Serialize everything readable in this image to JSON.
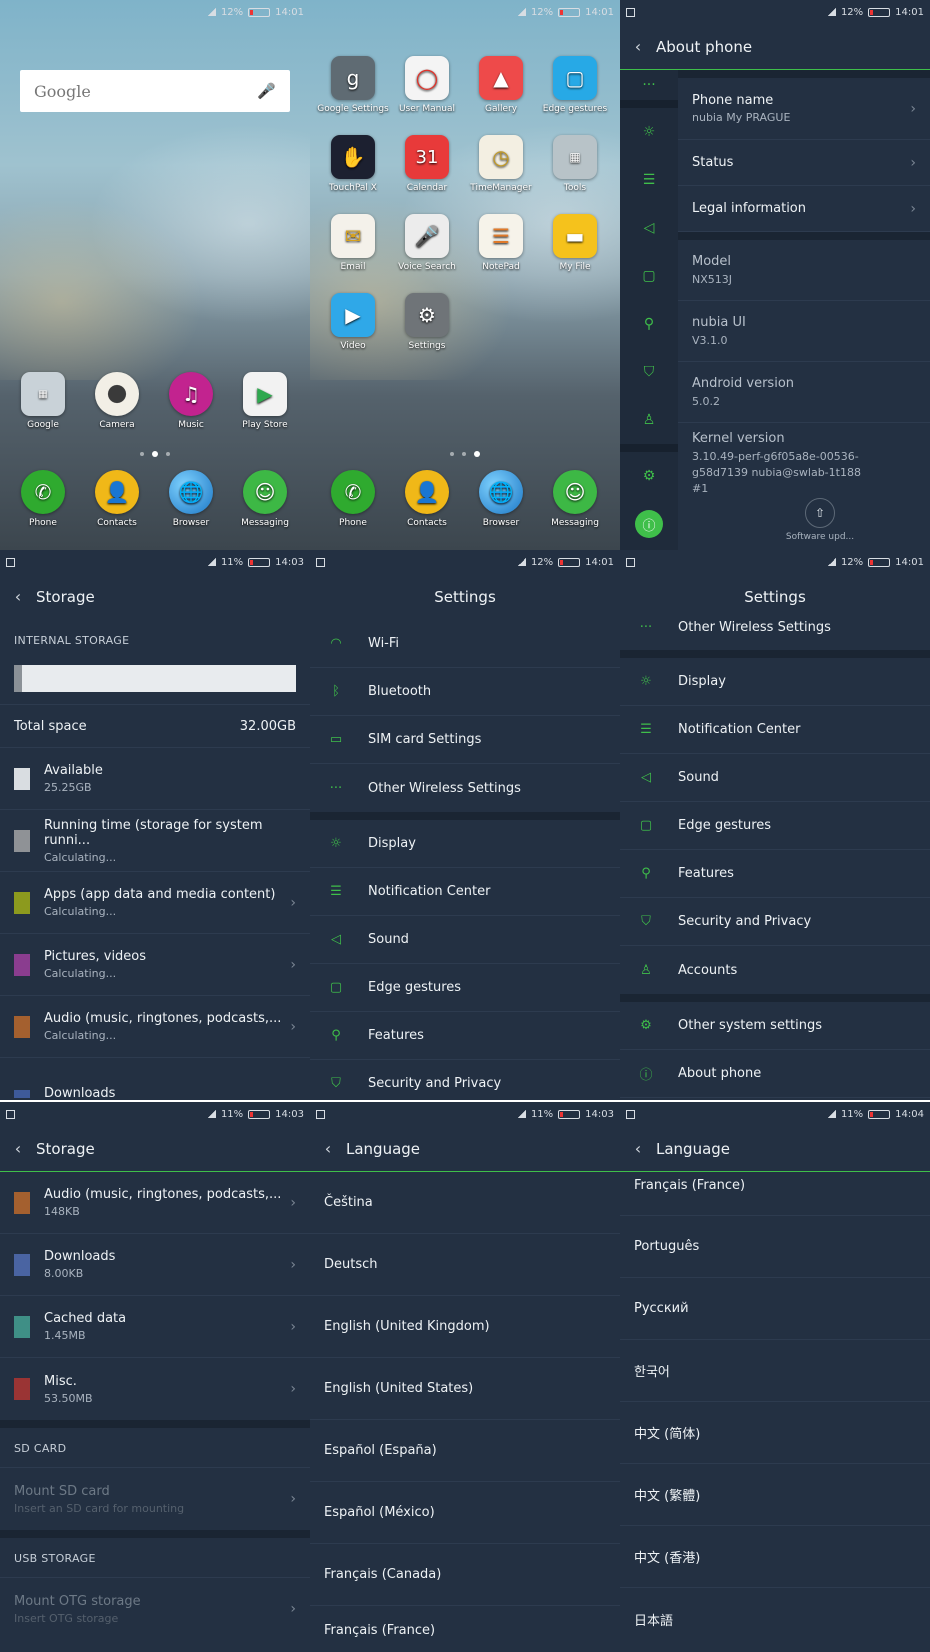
{
  "status": [
    {
      "battery": "12%",
      "time": "14:01"
    },
    {
      "battery": "12%",
      "time": "14:01"
    },
    {
      "battery": "12%",
      "time": "14:01"
    },
    {
      "battery": "11%",
      "time": "14:03"
    },
    {
      "battery": "12%",
      "time": "14:01"
    },
    {
      "battery": "12%",
      "time": "14:01"
    },
    {
      "battery": "11%",
      "time": "14:03"
    },
    {
      "battery": "11%",
      "time": "14:03"
    },
    {
      "battery": "11%",
      "time": "14:04"
    }
  ],
  "home1": {
    "search_label": "Google",
    "apps": [
      "Google",
      "Camera",
      "Music",
      "Play Store"
    ],
    "dock": [
      "Phone",
      "Contacts",
      "Browser",
      "Messaging"
    ]
  },
  "home2": {
    "apps": [
      "Google Settings",
      "User Manual",
      "Gallery",
      "Edge gestures",
      "TouchPal X",
      "Calendar",
      "TimeManager",
      "Tools",
      "Email",
      "Voice Search",
      "NotePad",
      "My File",
      "Video",
      "Settings"
    ],
    "calendar_day": "31",
    "dock": [
      "Phone",
      "Contacts",
      "Browser",
      "Messaging"
    ]
  },
  "about": {
    "title": "About phone",
    "phone_name_label": "Phone name",
    "phone_name_value": "nubia My PRAGUE",
    "status_label": "Status",
    "legal_label": "Legal information",
    "model_label": "Model",
    "model_value": "NX513J",
    "ui_label": "nubia UI",
    "ui_value": "V3.1.0",
    "android_label": "Android version",
    "android_value": "5.0.2",
    "kernel_label": "Kernel version",
    "kernel_value": "3.10.49-perf-g6f05a8e-00536-g58d7139 nubia@swlab-1t188 #1",
    "software_update": "Software upd..."
  },
  "storage1": {
    "title": "Storage",
    "section": "INTERNAL STORAGE",
    "total_label": "Total space",
    "total_value": "32.00GB",
    "items": [
      {
        "label": "Available",
        "sub": "25.25GB",
        "color": "#d9dde1"
      },
      {
        "label": "Running time (storage for system runni...",
        "sub": "Calculating...",
        "color": "#8f9296"
      },
      {
        "label": "Apps (app data and media content)",
        "sub": "Calculating...",
        "color": "#8c9a1e"
      },
      {
        "label": "Pictures, videos",
        "sub": "Calculating...",
        "color": "#8a3d8f"
      },
      {
        "label": "Audio (music, ringtones, podcasts,...",
        "sub": "Calculating...",
        "color": "#a4602f"
      },
      {
        "label": "Downloads",
        "sub": "",
        "color": "#3e5a9a"
      }
    ]
  },
  "settings1": {
    "title": "Settings",
    "items": [
      "Wi-Fi",
      "Bluetooth",
      "SIM card Settings",
      "Other Wireless Settings",
      "Display",
      "Notification Center",
      "Sound",
      "Edge gestures",
      "Features",
      "Security and Privacy"
    ]
  },
  "settings2": {
    "title": "Settings",
    "items": [
      "Other Wireless Settings",
      "Display",
      "Notification Center",
      "Sound",
      "Edge gestures",
      "Features",
      "Security and Privacy",
      "Accounts",
      "Other system settings",
      "About phone"
    ]
  },
  "storage2": {
    "title": "Storage",
    "items": [
      {
        "label": "Audio (music, ringtones, podcasts,...",
        "sub": "148KB",
        "color": "#a4602f"
      },
      {
        "label": "Downloads",
        "sub": "8.00KB",
        "color": "#4a64a2"
      },
      {
        "label": "Cached data",
        "sub": "1.45MB",
        "color": "#3f8f86"
      },
      {
        "label": "Misc.",
        "sub": "53.50MB",
        "color": "#9a3434"
      }
    ],
    "sd_section": "SD CARD",
    "sd_label": "Mount SD card",
    "sd_sub": "Insert an SD card for mounting",
    "usb_section": "USB STORAGE",
    "usb_label": "Mount OTG storage",
    "usb_sub": "Insert OTG storage"
  },
  "language1": {
    "title": "Language",
    "items": [
      "Čeština",
      "Deutsch",
      "English (United Kingdom)",
      "English (United States)",
      "Español (España)",
      "Español (México)",
      "Français (Canada)",
      "Français (France)"
    ]
  },
  "language2": {
    "title": "Language",
    "items": [
      "Français (France)",
      "Português",
      "Русский",
      "한국어",
      "中文 (简体)",
      "中文 (繁體)",
      "中文 (香港)",
      "日本語"
    ]
  }
}
